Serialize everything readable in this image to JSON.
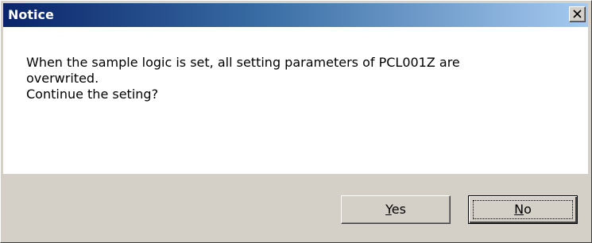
{
  "dialog": {
    "title": "Notice",
    "close_icon": "close-icon",
    "message_lines": [
      "When the sample logic is set, all setting parameters of PCL001Z are",
      "overwrited.",
      "Continue the seting?"
    ],
    "buttons": {
      "yes": {
        "accel": "Y",
        "rest": "es"
      },
      "no": {
        "accel": "N",
        "rest": "o"
      }
    }
  },
  "colors": {
    "title_gradient_start": "#0a246a",
    "title_gradient_end": "#a6caf0",
    "face": "#d4d0c8",
    "content_bg": "#ffffff"
  }
}
